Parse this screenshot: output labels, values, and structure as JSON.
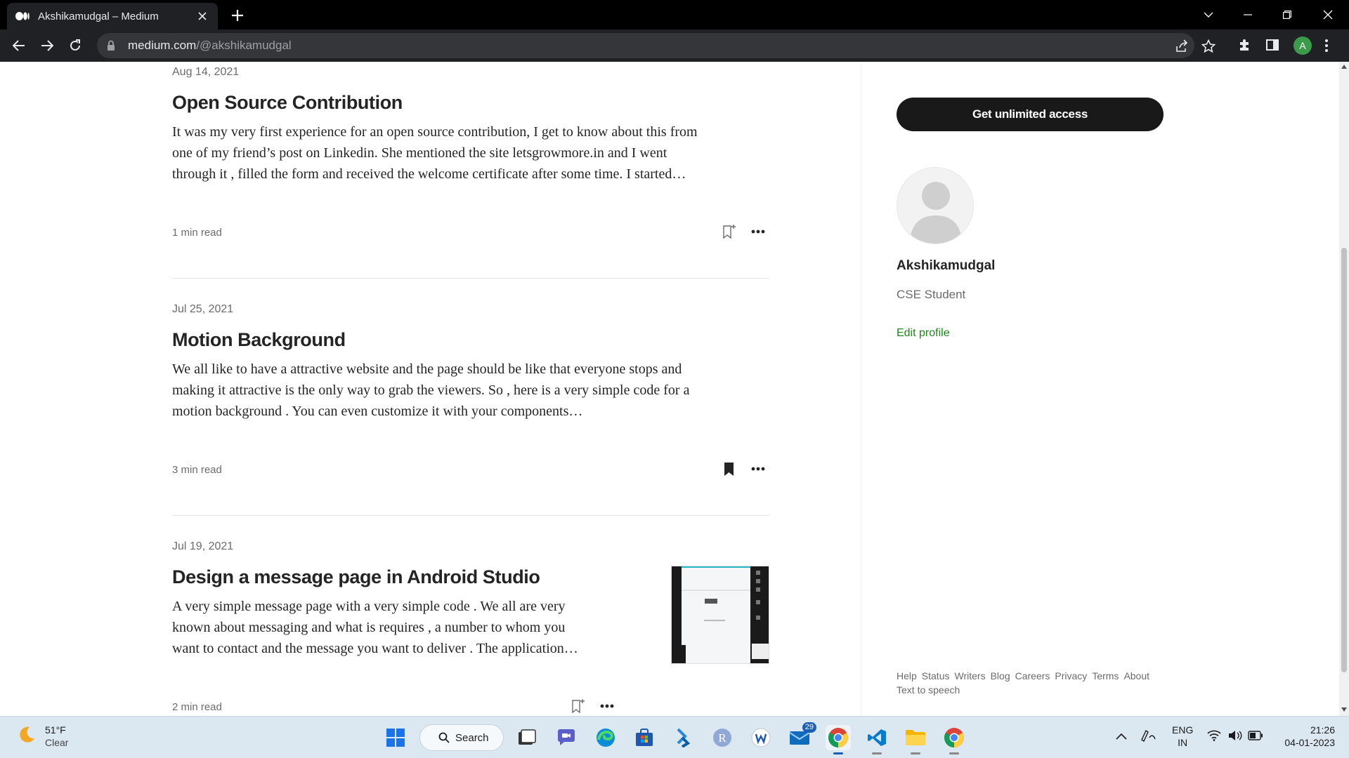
{
  "browser": {
    "tab_title": "Akshikamudgal – Medium",
    "url_host": "medium.com",
    "url_path": "/@akshikamudgal",
    "profile_initial": "A"
  },
  "articles": [
    {
      "date": "Aug 14, 2021",
      "title": "Open Source Contribution",
      "excerpt_lines": [
        "It was my very first experience for an open source contribution, I get to know about this from",
        "one of my friend’s post on Linkedin. She mentioned the site letsgrowmore.in and I went",
        "through it , filled the form and received the welcome certificate after some time. I started…"
      ],
      "read_time": "1 min read",
      "bookmarked": false
    },
    {
      "date": "Jul 25, 2021",
      "title": "Motion Background",
      "excerpt_lines": [
        "We all like to have a attractive website and the page should be like that everyone stops and",
        "making it attractive is the only way to grab the viewers. So , here is a very simple code for a",
        "motion background . You can even customize it with your components…"
      ],
      "read_time": "3 min read",
      "bookmarked": true
    },
    {
      "date": "Jul 19, 2021",
      "title": "Design a message page in Android Studio",
      "excerpt_lines": [
        "A very simple message page with a very simple code . We all are very",
        "known about messaging and what is requires , a number to whom you",
        "want to contact and the message you want to deliver . The application…"
      ],
      "read_time": "2 min read",
      "bookmarked": false
    }
  ],
  "sidebar": {
    "cta_label": "Get unlimited access",
    "name": "Akshikamudgal",
    "bio": "CSE Student",
    "edit_label": "Edit profile",
    "footer_links": [
      "Help",
      "Status",
      "Writers",
      "Blog",
      "Careers",
      "Privacy",
      "Terms",
      "About"
    ],
    "footer_extra": "Text to speech"
  },
  "taskbar": {
    "temperature": "51°F",
    "condition": "Clear",
    "search_label": "Search",
    "mail_badge": "29",
    "language": "ENG",
    "region": "IN",
    "time": "21:26",
    "date": "04-01-2023"
  },
  "colors": {
    "accent_green": "#1a8917",
    "cta_bg": "#191919",
    "browser_bg": "#202124"
  }
}
